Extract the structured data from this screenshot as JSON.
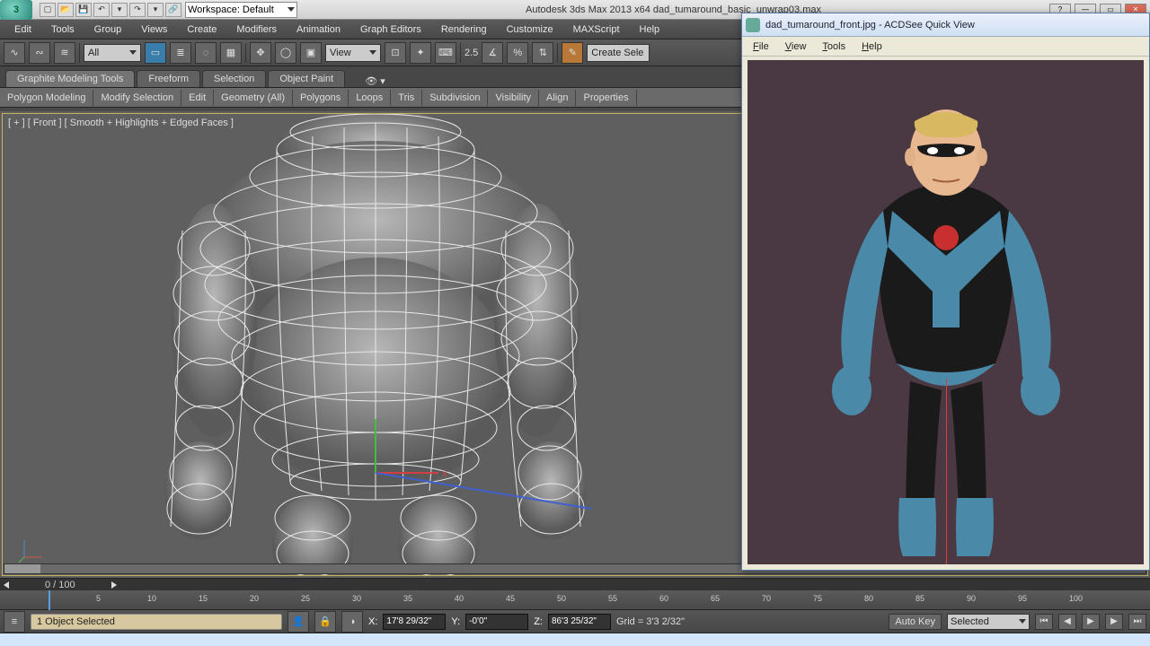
{
  "titlebar": {
    "workspace_label": "Workspace: Default",
    "app_title": "Autodesk 3ds Max  2013 x64     dad_tumaround_basic_unwrap03.max"
  },
  "menu": [
    "Edit",
    "Tools",
    "Group",
    "Views",
    "Create",
    "Modifiers",
    "Animation",
    "Graph Editors",
    "Rendering",
    "Customize",
    "MAXScript",
    "Help"
  ],
  "toolbar": {
    "filter": "All",
    "refsys": "View",
    "snap_val": "2.5",
    "create_btn": "Create Sele"
  },
  "ribbon": {
    "tabs": [
      "Graphite Modeling Tools",
      "Freeform",
      "Selection",
      "Object Paint"
    ],
    "sub": [
      "Polygon Modeling",
      "Modify Selection",
      "Edit",
      "Geometry (All)",
      "Polygons",
      "Loops",
      "Tris",
      "Subdivision",
      "Visibility",
      "Align",
      "Properties"
    ]
  },
  "viewport": {
    "label": "[ + ] [ Front ] [ Smooth + Highlights + Edged Faces ]"
  },
  "time": {
    "frame": "0 / 100",
    "ticks": [
      5,
      10,
      15,
      20,
      25,
      30,
      35,
      40,
      45,
      50,
      55,
      60,
      65,
      70,
      75,
      80,
      85,
      90,
      95,
      100
    ]
  },
  "status": {
    "selection": "1 Object Selected",
    "x": "17'8 29/32\"",
    "y": "-0'0\"",
    "z": "86'3 25/32\"",
    "grid": "Grid = 3'3 2/32\"",
    "autokey": "Auto Key",
    "filter_mode": "Selected"
  },
  "acd": {
    "title": "dad_tumaround_front.jpg - ACDSee Quick View",
    "menu": [
      "File",
      "View",
      "Tools",
      "Help"
    ]
  }
}
